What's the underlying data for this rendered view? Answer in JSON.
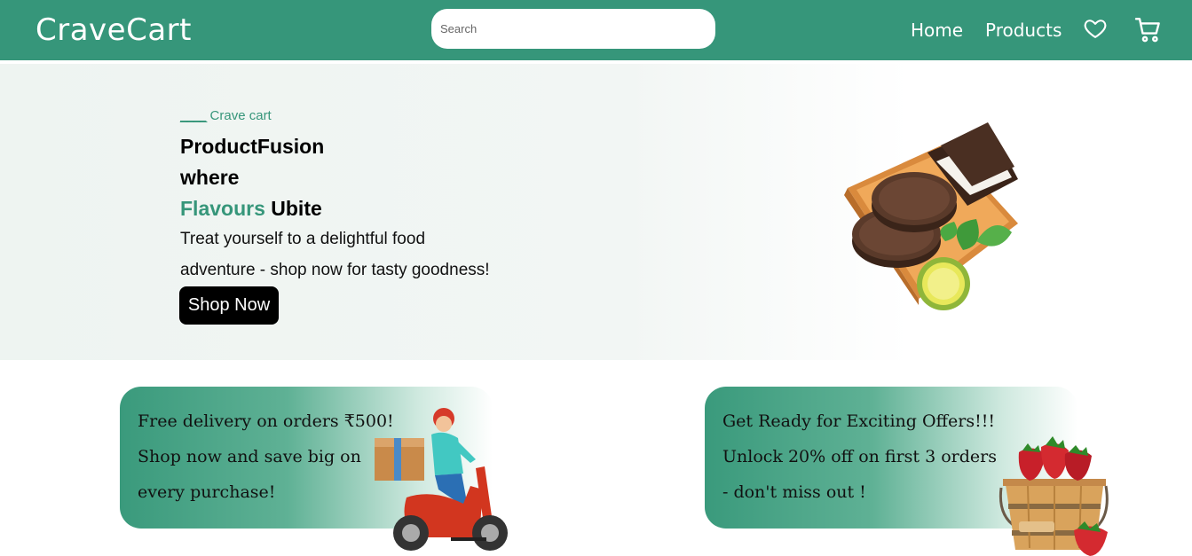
{
  "navbar": {
    "logo": "CraveCart",
    "search_placeholder": "Search",
    "home": "Home",
    "products": "Products",
    "heart_icon": "heart-icon",
    "cart_icon": "cart-icon",
    "bg_color": "#36967a"
  },
  "hero": {
    "tag_dash": "____",
    "tag": " Crave cart",
    "line1": "ProductFusion",
    "line2": "where",
    "line3_accent": "Flavours",
    "line3_rest": " Ubite",
    "desc1": "Treat yourself to a delightful food",
    "desc2": "adventure - shop now for tasty goodness!",
    "button": "Shop Now",
    "accent_color": "#36967a"
  },
  "promos": [
    {
      "line1": "Free delivery on orders ₹500!",
      "line2": "Shop now and save big on",
      "line3": "every purchase!"
    },
    {
      "line1": " Get Ready for Exciting Offers!!!",
      "line2": "Unlock 20% off on first 3 orders",
      "line3": "- don't miss out !"
    }
  ]
}
